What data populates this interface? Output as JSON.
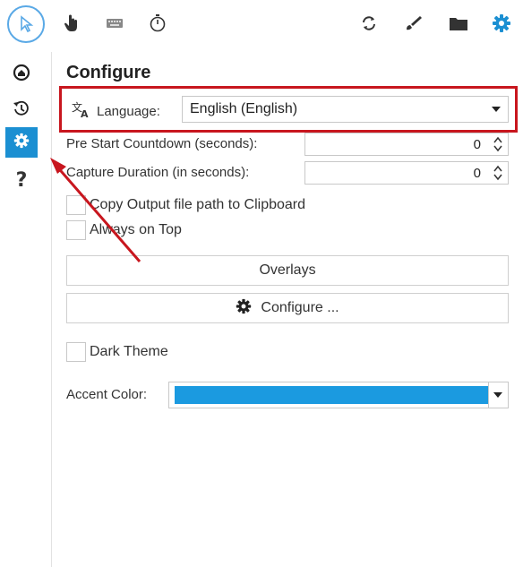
{
  "toolbar": {
    "icons": [
      "cursor-icon",
      "hand-icon",
      "keyboard-icon",
      "timer-icon",
      "sync-icon",
      "brush-icon",
      "folder-icon",
      "gear-icon"
    ]
  },
  "sidebar": {
    "items": [
      "home-icon",
      "history-icon",
      "gear-icon"
    ],
    "help_label": "?"
  },
  "main": {
    "title": "Configure",
    "language": {
      "label": "Language:",
      "value": "English (English)"
    },
    "pre_start": {
      "label": "Pre Start Countdown (seconds):",
      "value": "0"
    },
    "capture_duration": {
      "label": "Capture Duration (in seconds):",
      "value": "0"
    },
    "copy_output": {
      "label": "Copy Output file path to Clipboard",
      "checked": false
    },
    "always_on_top": {
      "label": "Always on Top",
      "checked": false
    },
    "overlays_label": "Overlays",
    "configure_label": "Configure ...",
    "dark_theme": {
      "label": "Dark Theme",
      "checked": false
    },
    "accent": {
      "label": "Accent Color:",
      "color": "#1b9ae0"
    }
  },
  "colors": {
    "highlight_red": "#c8161e",
    "active_blue": "#1b8fd2",
    "cursor_ring": "#5aa9e6"
  }
}
